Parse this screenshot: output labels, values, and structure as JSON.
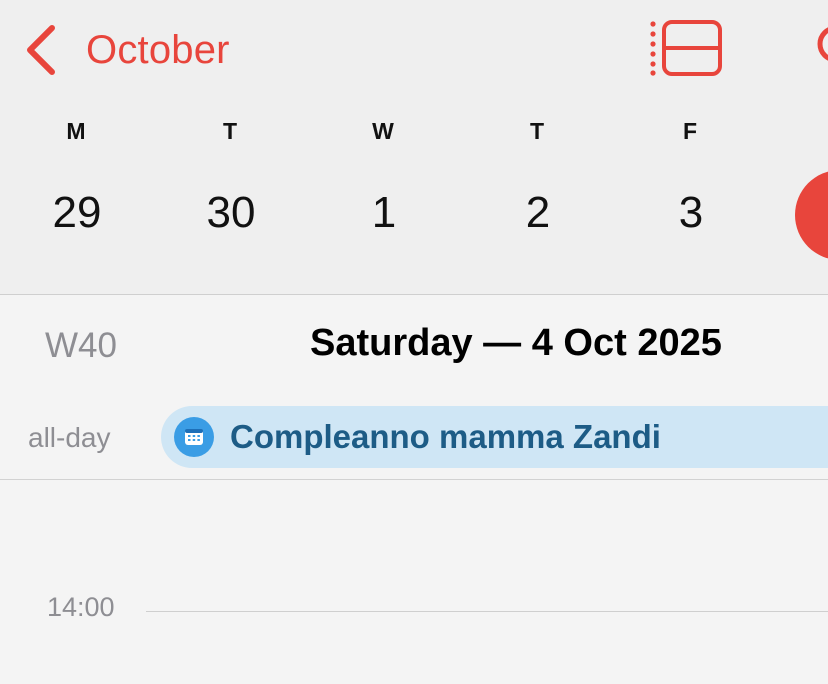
{
  "header": {
    "back_label": "October",
    "accent_color": "#e8453c",
    "icons": {
      "back": "chevron-left-icon",
      "list_view": "list-view-icon",
      "search": "search-icon"
    }
  },
  "week": {
    "days": [
      {
        "weekday": "M",
        "date": "29"
      },
      {
        "weekday": "T",
        "date": "30"
      },
      {
        "weekday": "W",
        "date": "1"
      },
      {
        "weekday": "T",
        "date": "2"
      },
      {
        "weekday": "F",
        "date": "3"
      }
    ]
  },
  "day_view": {
    "week_number": "W40",
    "title": "Saturday — 4 Oct 2025",
    "allday_label": "all-day",
    "allday_event": {
      "title": "Compleanno mamma Zandi",
      "icon": "calendar-icon",
      "color": "#cfe6f5"
    },
    "time_labels": [
      "14:00"
    ]
  }
}
